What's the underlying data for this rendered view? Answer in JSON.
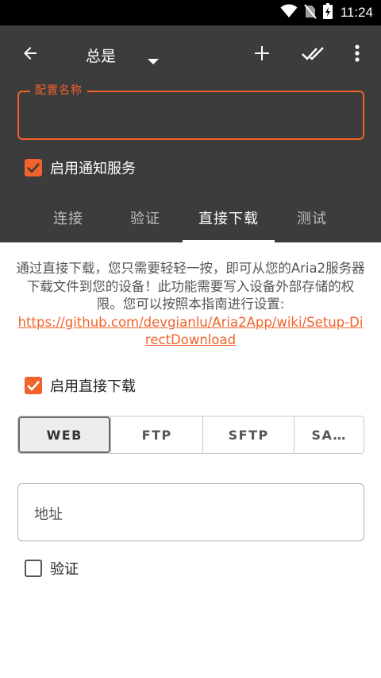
{
  "status_bar": {
    "time": "11:24",
    "icons": [
      "wifi-icon",
      "no-sim-icon",
      "battery-charging-icon"
    ]
  },
  "toolbar": {
    "back_icon": "arrow-left-icon",
    "title": "总是",
    "dropdown_icon": "caret-down-icon",
    "add_icon": "plus-icon",
    "done_all_icon": "double-check-icon",
    "overflow_icon": "more-vertical-icon"
  },
  "profile_name_field": {
    "label": "配置名称",
    "value": ""
  },
  "enable_notifications": {
    "label": "启用通知服务",
    "checked": true
  },
  "tabs": [
    {
      "label": "连接",
      "active": false
    },
    {
      "label": "验证",
      "active": false
    },
    {
      "label": "直接下载",
      "active": true
    },
    {
      "label": "测试",
      "active": false
    }
  ],
  "direct_download": {
    "description": "通过直接下载，您只需要轻轻一按，即可从您的Aria2服务器下载文件到您的设备！此功能需要写入设备外部存储的权限。您可以按照本指南进行设置:",
    "link": "https://github.com/devgianlu/Aria2App/wiki/Setup-DirectDownload",
    "enable_label": "启用直接下载",
    "enable_checked": true,
    "protocols": [
      {
        "label": "WEB",
        "selected": true
      },
      {
        "label": "FTP",
        "selected": false
      },
      {
        "label": "SFTP",
        "selected": false
      },
      {
        "label": "SA…",
        "selected": false
      }
    ],
    "address_placeholder": "地址",
    "auth_label": "验证",
    "auth_checked": false
  },
  "colors": {
    "accent": "#f2622b",
    "header_bg": "#3c3c3c",
    "status_bar_bg": "#000000"
  }
}
